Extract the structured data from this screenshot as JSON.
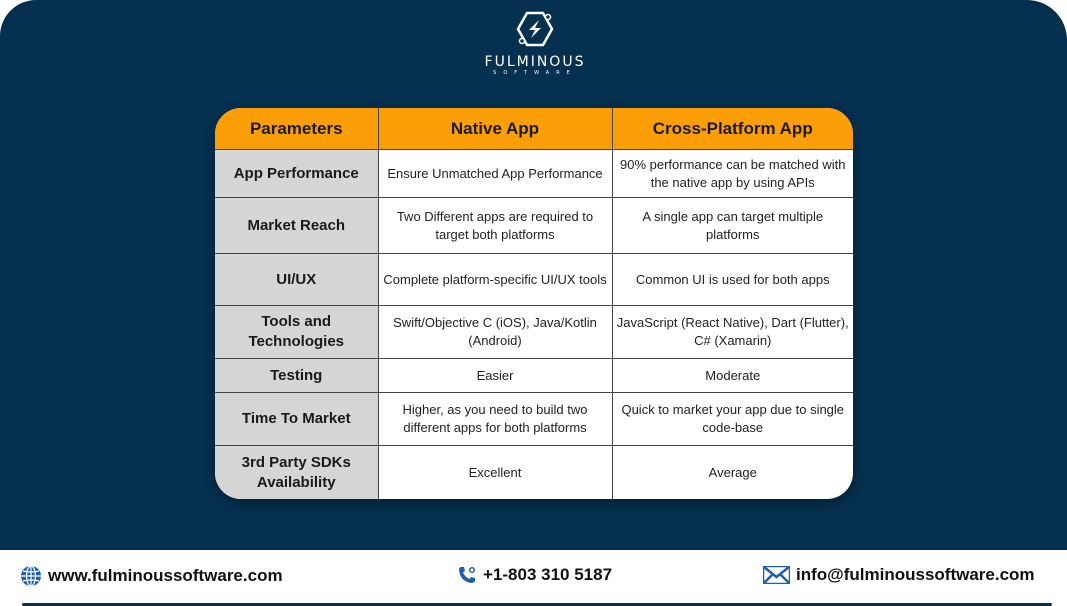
{
  "brand": {
    "name": "FULMINOUS",
    "tagline": "SOFTWARE"
  },
  "table": {
    "headers": [
      "Parameters",
      "Native App",
      "Cross-Platform App"
    ],
    "rows": [
      {
        "parameter": "App Performance",
        "native": "Ensure Unmatched App Performance",
        "cross": "90% performance can be matched with the native app by using APIs"
      },
      {
        "parameter": "Market Reach",
        "native": "Two Different apps are required to target both platforms",
        "cross": "A single app can target multiple platforms"
      },
      {
        "parameter": "UI/UX",
        "native": "Complete platform-specific UI/UX tools",
        "cross": "Common UI is used for both apps"
      },
      {
        "parameter": "Tools and Technologies",
        "native": "Swift/Objective C (iOS), Java/Kotlin (Android)",
        "cross": "JavaScript (React Native), Dart (Flutter), C# (Xamarin)"
      },
      {
        "parameter": "Testing",
        "native": "Easier",
        "cross": "Moderate"
      },
      {
        "parameter": "Time To Market",
        "native": "Higher, as you need to build two different apps for both platforms",
        "cross": "Quick to market your app due to single code-base"
      },
      {
        "parameter": "3rd Party SDKs Availability",
        "native": "Excellent",
        "cross": "Average"
      }
    ]
  },
  "footer": {
    "website": {
      "icon": "globe-icon",
      "text": "www.fulminoussoftware.com"
    },
    "phone": {
      "icon": "phone-icon",
      "text": "+1-803 310 5187"
    },
    "email": {
      "icon": "mail-icon",
      "text": "info@fulminoussoftware.com"
    }
  },
  "colors": {
    "background": "#06304f",
    "header": "#fb9e08",
    "param_cell": "#d5d5d5",
    "icon_blue": "#1f5fae"
  }
}
